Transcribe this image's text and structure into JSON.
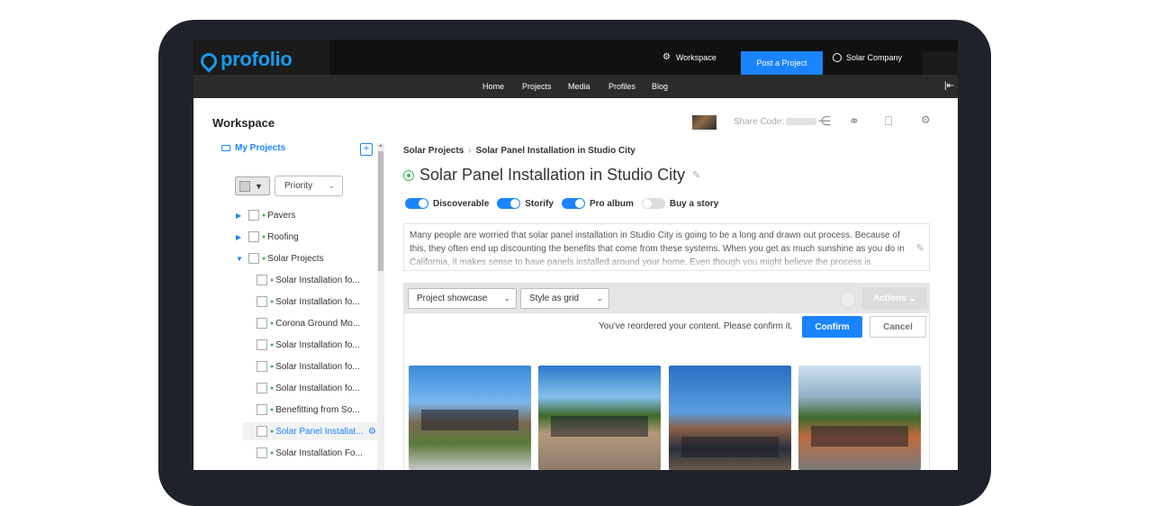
{
  "app": {
    "logo": "profolio"
  },
  "top": {
    "workspace_label": "Workspace",
    "post_label": "Post a Project",
    "user_label": "Solar Company"
  },
  "nav": [
    "Home",
    "Projects",
    "Media",
    "Profiles",
    "Blog"
  ],
  "header": {
    "title": "Workspace",
    "share_code_label": "Share Code:"
  },
  "sidebar": {
    "my_projects": "My Projects",
    "priority": "Priority",
    "tree": [
      {
        "label": "Pavers"
      },
      {
        "label": "Roofing"
      },
      {
        "label": "Solar Projects"
      },
      {
        "label": "Solar Installation fo..."
      },
      {
        "label": "Solar Installation fo..."
      },
      {
        "label": "Corona Ground Mo..."
      },
      {
        "label": "Solar Installation fo..."
      },
      {
        "label": "Solar Installation fo..."
      },
      {
        "label": "Solar Installation fo..."
      },
      {
        "label": "Benefitting from So..."
      },
      {
        "label": "Solar Panel Installat..."
      },
      {
        "label": "Solar Installation Fo..."
      }
    ]
  },
  "main": {
    "breadcrumb": [
      "Solar Projects",
      "Solar Panel Installation in Studio City"
    ],
    "title": "Solar Panel Installation in Studio City",
    "toggles": [
      {
        "label": "Discoverable",
        "on": true
      },
      {
        "label": "Storify",
        "on": true
      },
      {
        "label": "Pro album",
        "on": true
      },
      {
        "label": "Buy a story",
        "on": false
      }
    ],
    "description": "Many people are worried that solar panel installation in Studio City is going to be a long and drawn out process. Because of this, they often end up discounting the benefits that come from these systems. When you get as much sunshine as you do in California, it makes sense to have panels installed around your home. Even though you might believe the process is",
    "view_select": "Project showcase",
    "style_select": "Style as grid",
    "actions_label": "Actions",
    "reorder_message": "You've reordered your content. Please confirm it.",
    "confirm_label": "Confirm",
    "cancel_label": "Cancel"
  },
  "colors": {
    "accent": "#1a84ff",
    "green": "#3bb54a",
    "dark": "#1f222a"
  }
}
